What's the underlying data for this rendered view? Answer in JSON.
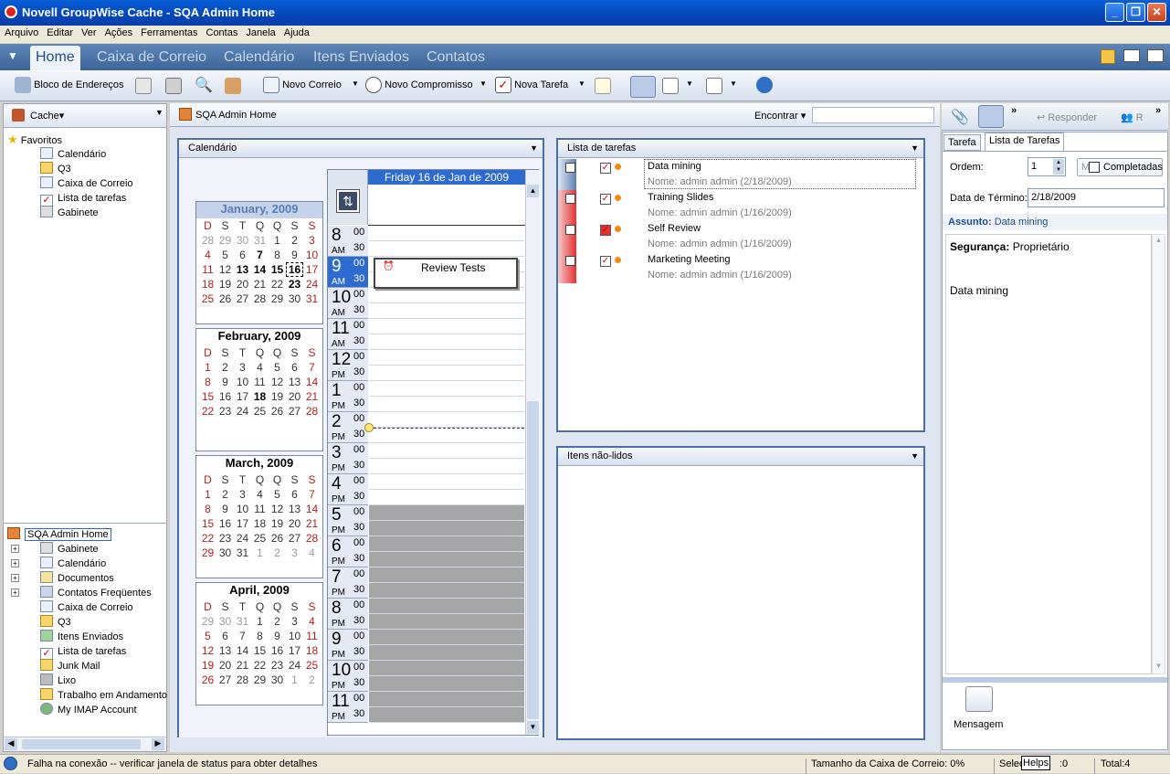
{
  "window": {
    "title": "Novell GroupWise Cache - SQA Admin Home"
  },
  "menu": [
    "Arquivo",
    "Editar",
    "Ver",
    "Ações",
    "Ferramentas",
    "Contas",
    "Janela",
    "Ajuda"
  ],
  "tabs": [
    "Home",
    "Caixa de Correio",
    "Calendário",
    "Itens Enviados",
    "Contatos"
  ],
  "toolbar": {
    "address_book": "Bloco de Endereços",
    "new_mail": "Novo Correio",
    "new_appt": "Novo Compromisso",
    "new_task": "Nova Tarefa"
  },
  "left": {
    "cache_label": "Cache",
    "favorites_label": "Favoritos",
    "favorites": [
      "Calendário",
      "Q3",
      "Caixa de Correio",
      "Lista de tarefas",
      "Gabinete"
    ],
    "home_label": "SQA Admin Home",
    "folders": [
      "Gabinete",
      "Calendário",
      "Documentos",
      "Contatos Freqüentes",
      "Caixa de Correio",
      "Q3",
      "Itens Enviados",
      "Lista de tarefas",
      "Junk Mail",
      "Lixo",
      "Trabalho em Andamento",
      "My IMAP Account"
    ]
  },
  "breadcrumb": "SQA Admin Home",
  "find_label": "Encontrar",
  "calendar": {
    "panel_title": "Calendário",
    "day_header": "Friday 16 de Jan de 2009",
    "weekdays": [
      "D",
      "S",
      "T",
      "Q",
      "Q",
      "S",
      "S"
    ],
    "months": [
      {
        "title": "January, 2009"
      },
      {
        "title": "February, 2009"
      },
      {
        "title": "March, 2009"
      },
      {
        "title": "April, 2009"
      }
    ],
    "appointment": "Review Tests"
  },
  "tasks": {
    "panel_title": "Lista de tarefas",
    "items": [
      {
        "title": "Data mining",
        "sub": "Nome: admin admin (2/18/2009)"
      },
      {
        "title": "Training Slides",
        "sub": "Nome: admin admin (1/16/2009)"
      },
      {
        "title": "Self Review",
        "sub": "Nome: admin admin (1/16/2009)"
      },
      {
        "title": "Marketing Meeting",
        "sub": "Nome: admin admin (1/16/2009)"
      }
    ]
  },
  "unread": {
    "panel_title": "Itens não-lidos"
  },
  "right": {
    "reply_label": "Responder",
    "tab_task": "Tarefa",
    "tab_list": "Lista de Tarefas",
    "order_label": "Ordem:",
    "order_value": "1",
    "completed_label": "Completadas",
    "due_label": "Data de Término:",
    "due_value": "2/18/2009",
    "subject_label": "Assunto:",
    "subject_value": "Data mining",
    "security_label": "Segurança:",
    "security_value": "Proprietário",
    "body_text": "Data mining",
    "message_label": "Mensagem"
  },
  "status": {
    "connection": "Falha na conexão -- verificar janela de status para obter detalhes",
    "mailbox_size": "Tamanho da Caixa de Correio: 0%",
    "selected": "Selec",
    "helps": "Helps",
    "selected_count": ":0",
    "total": "Total:4"
  }
}
